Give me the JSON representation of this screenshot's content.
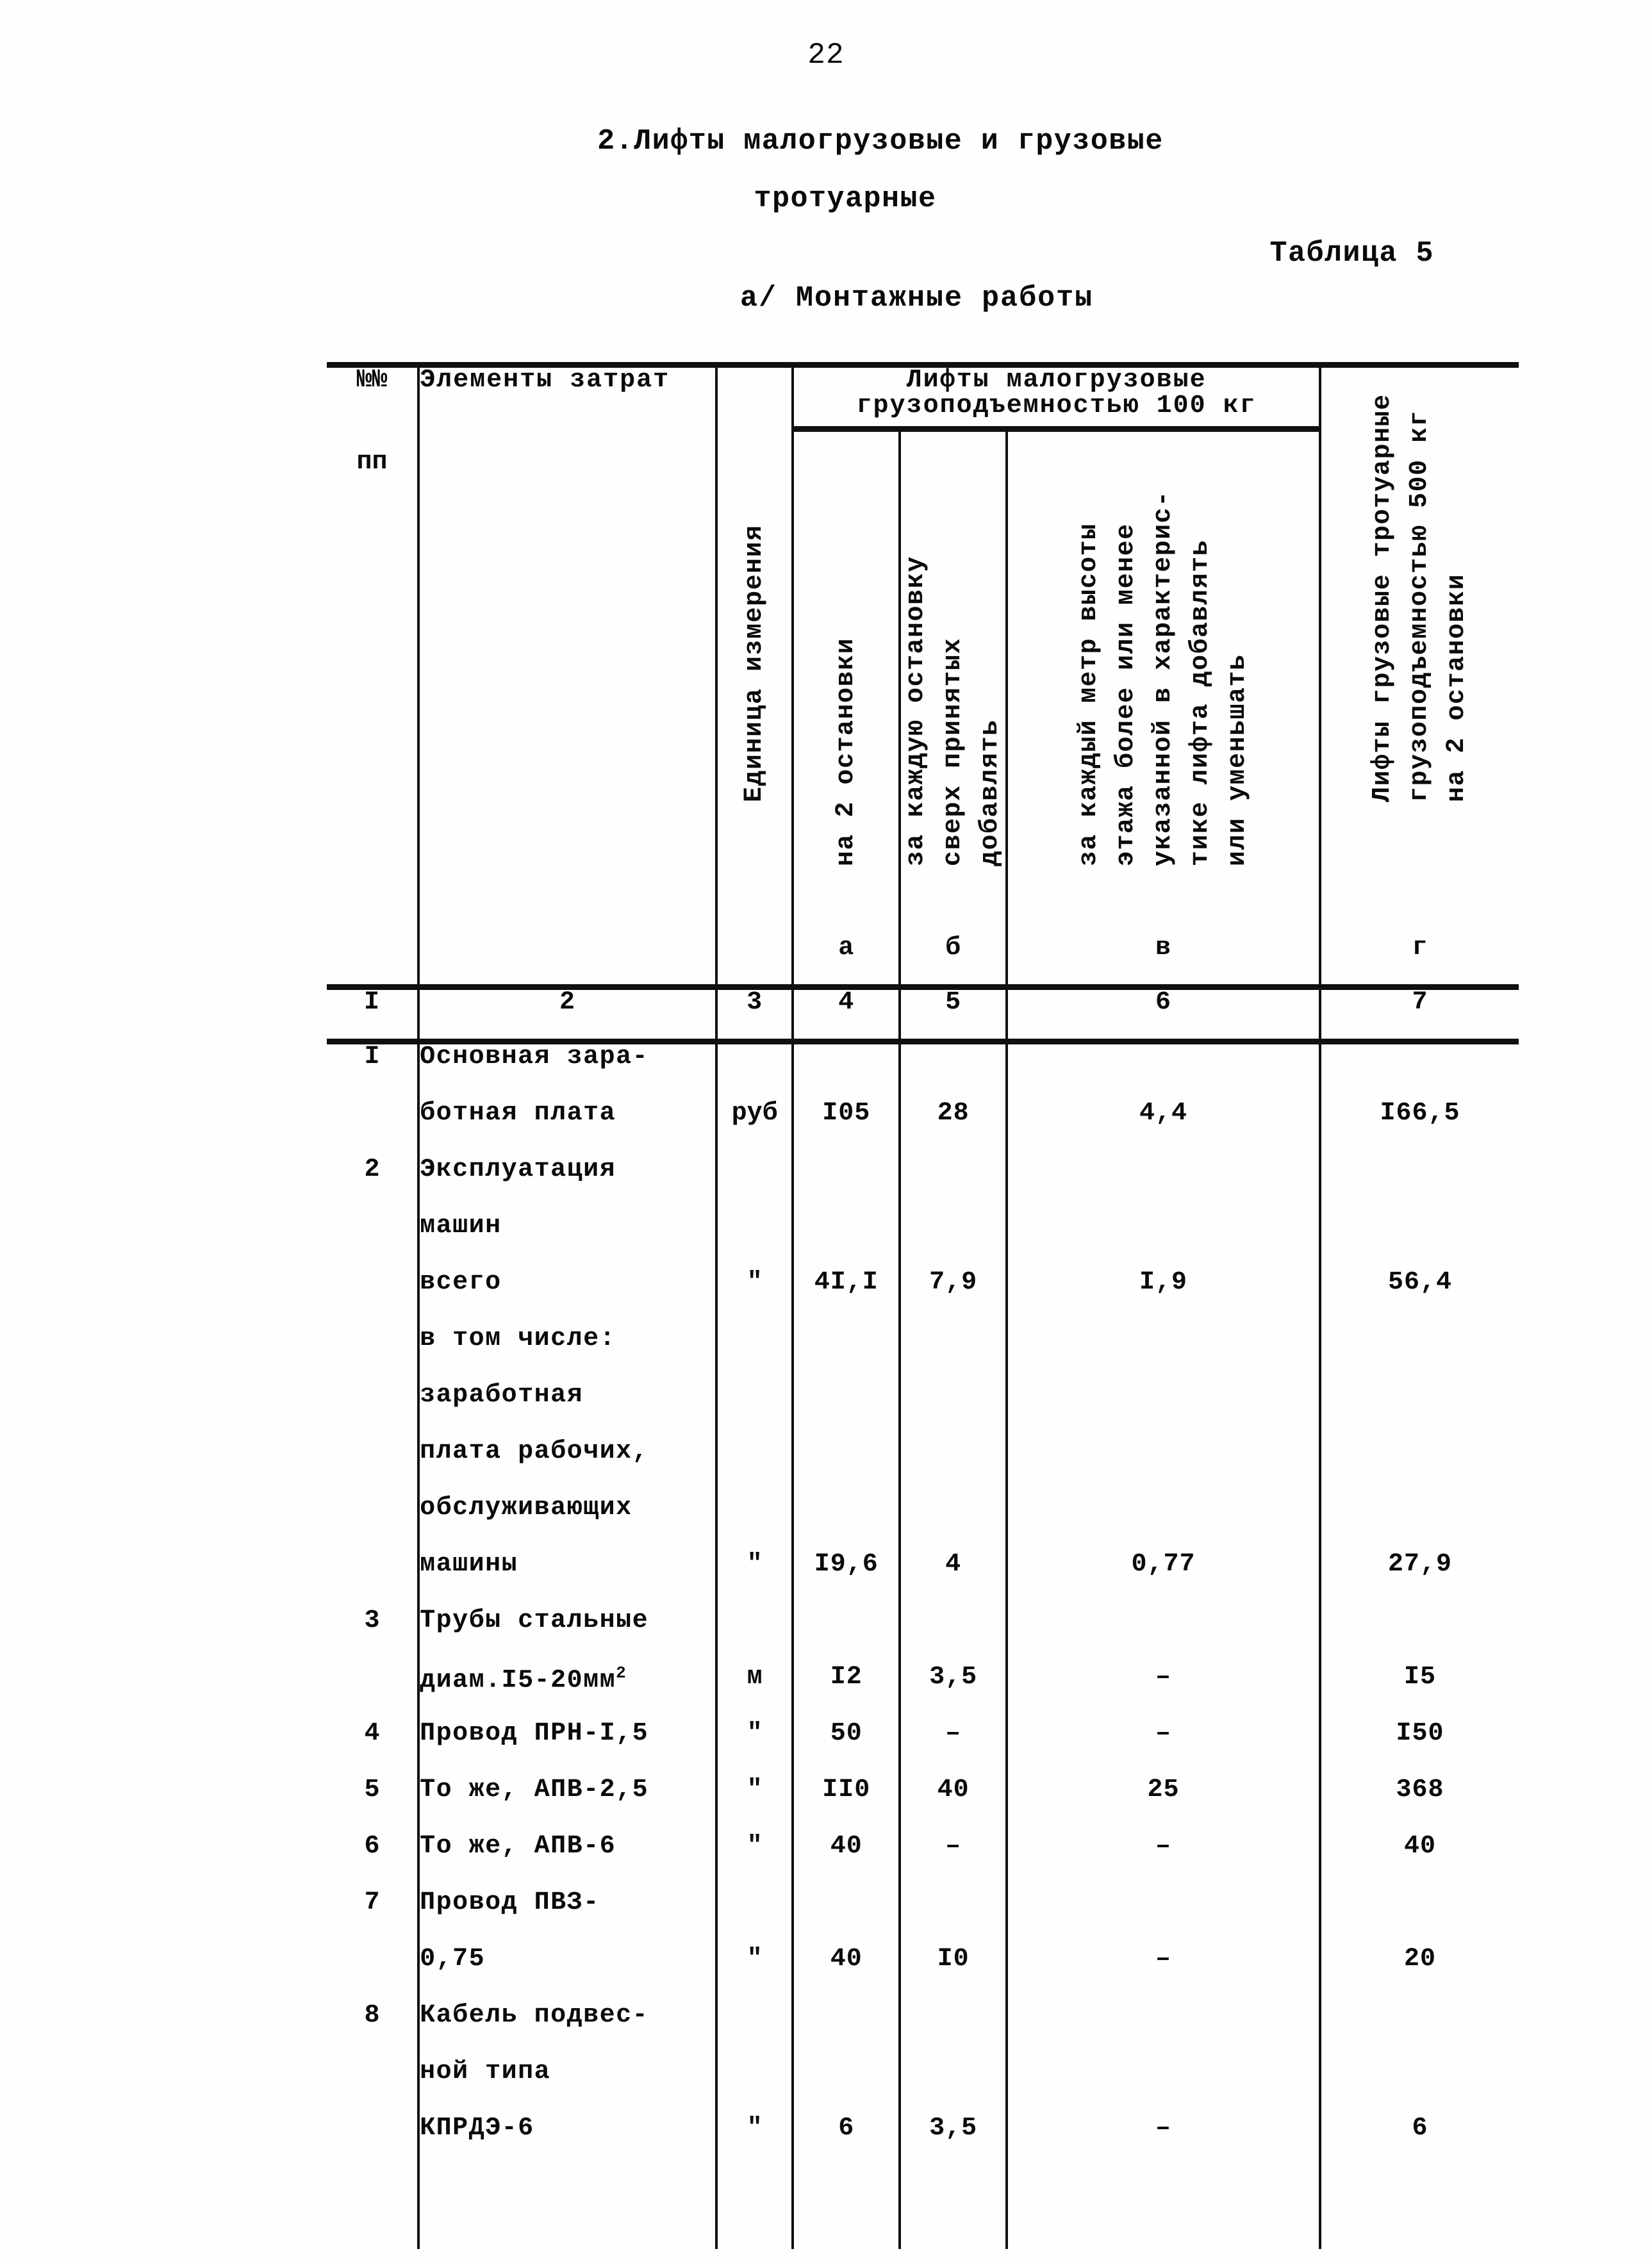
{
  "page": {
    "number": "22",
    "heading_line1": "2.Лифты малогрузовые и грузовые",
    "heading_line2": "тротуарные",
    "table_label": "Таблица 5",
    "subsection": "а/ Монтажные работы"
  },
  "table": {
    "columns": {
      "no_line1": "№№",
      "no_line2": "пп",
      "elements": "Элементы затрат",
      "unit": "Единица измерения",
      "group_line1": "Лифты малогрузовые",
      "group_line2": "грузоподъемностью 100 кг",
      "col_a": "на 2 остановки",
      "col_b": "за каждую остановку\nсверх принятых\nдобавлять",
      "col_v": "за каждый метр высоты\nэтажа более или менее\nуказанной в характерис-\nтике лифта добавлять\nили уменьшать",
      "col_g": "Лифты грузовые тротуарные\nгрузоподъемностью 500 кг\nна 2 остановки"
    },
    "letter_row": [
      "",
      "",
      "",
      "а",
      "б",
      "в",
      "г"
    ],
    "number_row": [
      "I",
      "2",
      "3",
      "4",
      "5",
      "6",
      "7"
    ],
    "rows": [
      {
        "no": "I",
        "elem": "Основная зара-",
        "unit": "",
        "a": "",
        "b": "",
        "v": "",
        "g": ""
      },
      {
        "no": "",
        "elem": "ботная плата",
        "unit": "руб",
        "a": "I05",
        "b": "28",
        "v": "4,4",
        "g": "I66,5"
      },
      {
        "no": "2",
        "elem": "Эксплуатация",
        "unit": "",
        "a": "",
        "b": "",
        "v": "",
        "g": ""
      },
      {
        "no": "",
        "elem": "машин",
        "unit": "",
        "a": "",
        "b": "",
        "v": "",
        "g": ""
      },
      {
        "no": "",
        "elem": "всего",
        "unit": "\"",
        "a": "4I,I",
        "b": "7,9",
        "v": "I,9",
        "g": "56,4"
      },
      {
        "no": "",
        "elem": "в том числе:",
        "unit": "",
        "a": "",
        "b": "",
        "v": "",
        "g": ""
      },
      {
        "no": "",
        "elem": "заработная",
        "unit": "",
        "a": "",
        "b": "",
        "v": "",
        "g": ""
      },
      {
        "no": "",
        "elem": "плата рабочих,",
        "unit": "",
        "a": "",
        "b": "",
        "v": "",
        "g": ""
      },
      {
        "no": "",
        "elem": "обслуживающих",
        "unit": "",
        "a": "",
        "b": "",
        "v": "",
        "g": ""
      },
      {
        "no": "",
        "elem": "машины",
        "unit": "\"",
        "a": "I9,6",
        "b": "4",
        "v": "0,77",
        "g": "27,9"
      },
      {
        "no": "3",
        "elem": "Трубы стальные",
        "unit": "",
        "a": "",
        "b": "",
        "v": "",
        "g": ""
      },
      {
        "no": "",
        "elem": "диам.I5-20мм",
        "elem_sup": "2",
        "unit": "м",
        "a": "I2",
        "b": "3,5",
        "v": "–",
        "g": "I5"
      },
      {
        "no": "4",
        "elem": "Провод ПРН-I,5",
        "unit": "\"",
        "a": "50",
        "b": "–",
        "v": "–",
        "g": "I50"
      },
      {
        "no": "5",
        "elem": "То же, АПВ-2,5",
        "unit": "\"",
        "a": "II0",
        "b": "40",
        "v": "25",
        "g": "368"
      },
      {
        "no": "6",
        "elem": "То же, АПВ-6",
        "unit": "\"",
        "a": "40",
        "b": "–",
        "v": "–",
        "g": "40"
      },
      {
        "no": "7",
        "elem": "Провод ПВЗ-",
        "unit": "",
        "a": "",
        "b": "",
        "v": "",
        "g": ""
      },
      {
        "no": "",
        "elem": "0,75",
        "unit": "\"",
        "a": "40",
        "b": "I0",
        "v": "–",
        "g": "20"
      },
      {
        "no": "8",
        "elem": "Кабель подвес-",
        "unit": "",
        "a": "",
        "b": "",
        "v": "",
        "g": ""
      },
      {
        "no": "",
        "elem": "ной типа",
        "unit": "",
        "a": "",
        "b": "",
        "v": "",
        "g": ""
      },
      {
        "no": "",
        "elem": "КПРДЭ-6",
        "unit": "\"",
        "a": "6",
        "b": "3,5",
        "v": "–",
        "g": "6"
      }
    ]
  }
}
